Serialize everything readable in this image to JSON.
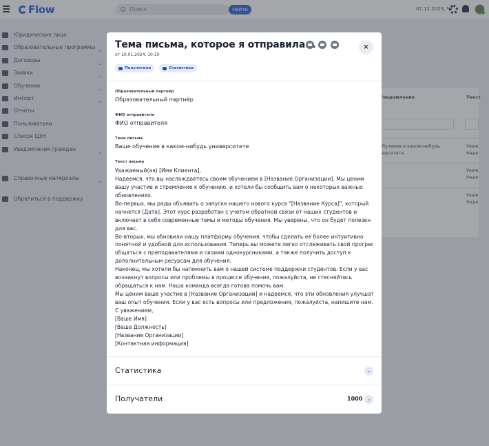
{
  "topbar": {
    "logo": "Flow",
    "search_placeholder": "Поиск",
    "search_button": "Найти",
    "date": "07.12.2023, Чт"
  },
  "sidebar": {
    "items": [
      {
        "label": "Юридические лица",
        "icon": "building-icon",
        "chevron": false
      },
      {
        "label": "Образовательные программы",
        "icon": "program-icon",
        "chevron": true
      },
      {
        "label": "Договоры",
        "icon": "contract-icon",
        "chevron": true
      },
      {
        "label": "Заявки",
        "icon": "application-icon",
        "chevron": true
      },
      {
        "label": "Обучение",
        "icon": "education-icon",
        "chevron": true
      },
      {
        "label": "Импорт",
        "icon": "import-icon",
        "chevron": true
      },
      {
        "label": "Отчёты",
        "icon": "reports-icon",
        "chevron": false
      },
      {
        "label": "Пользователи",
        "icon": "users-icon",
        "chevron": false
      },
      {
        "label": "Список ЦЗН",
        "icon": "list-icon",
        "chevron": false
      },
      {
        "label": "Уведомления граждан",
        "icon": "notification-icon",
        "chevron": true
      }
    ],
    "reference": {
      "label": "Справочные материалы",
      "chevron": true
    },
    "support": {
      "label": "Обратиться в поддержку"
    }
  },
  "background_table": {
    "col1": "Уведомления",
    "col2": "Текст",
    "rows": [
      {
        "c1": [
          "обучение в каком-нибудь",
          "верситете"
        ],
        "c2": [
          "Уваж",
          "Наде"
        ]
      },
      {
        "c1": [
          "",
          ""
        ],
        "c2": [
          "Уваж",
          "Наде"
        ]
      },
      {
        "c1": [
          "",
          ""
        ],
        "c2": [
          "Уваж",
          "Наде"
        ]
      }
    ]
  },
  "modal": {
    "title": "Тема письма, которое я отправила...",
    "subtitle": "от 10.01.2024, 10:10",
    "chips": {
      "recipients": "Получатели",
      "statistics": "Статистика"
    },
    "partner_label": "Образовательный партнёр",
    "partner_value": "Образовательный партнёр",
    "sender_label": "ФИО отправителя",
    "sender_value": "ФИО отправителя",
    "subject_label": "Тема письма",
    "subject_value": "Ваше обучение в каком-нибудь университете",
    "body_label": "Текст письма",
    "body_lines": [
      "Уважаемый(ая) [Имя Клиента],",
      "Надеемся, что вы наслаждаетесь своим обучением в [Название Организации]. Мы ценим",
      "вашу участие и стремление к обучению, и хотели бы сообщить вам о некоторых важных",
      "обновлениях.",
      "Во-первых, мы рады объявить о запуске нашего нового курса \"[Название Курса]\", который",
      "начнется [Дата]. Этот курс разработан с учетом обратной связи от наших студентов и",
      "включает в себя современные темы и методы обучения. Мы уверены, что он будет полезен",
      "для вас.",
      "Во-вторых, мы обновили нашу платформу обучения, чтобы сделать ее более интуитивно",
      "понятной и удобной для использования. Теперь вы можете легко отслеживать свой прогресс,",
      "общаться с преподавателями и своими однокурсниками, а также получить доступ к",
      "дополнительным ресурсам для обучения.",
      "Наконец, мы хотели бы напомнить вам о нашей системе поддержки студентов. Если у вас",
      "возникнут вопросы или проблемы в процессе обучения, пожалуйста, не стесняйтесь",
      "обращаться к нам. Наша команда всегда готова помочь вам.",
      "Мы ценим ваше участие в [Название Организации] и надеемся, что эти обновления улучшат",
      "ваш опыт обучения. Если у вас есть вопросы или предложения, пожалуйста, напишите нам.",
      "С уважением,",
      "[Ваше Имя]",
      "[Ваша Должность]",
      "[Название Организации]",
      "[Контактная информация]"
    ],
    "statistics_label": "Статистика",
    "recipients_label": "Получатели",
    "recipients_count": "1000",
    "close_label": "×",
    "chevron": "⌄",
    "icons": [
      "email-icon",
      "telegram-icon",
      "chat-icon"
    ]
  }
}
